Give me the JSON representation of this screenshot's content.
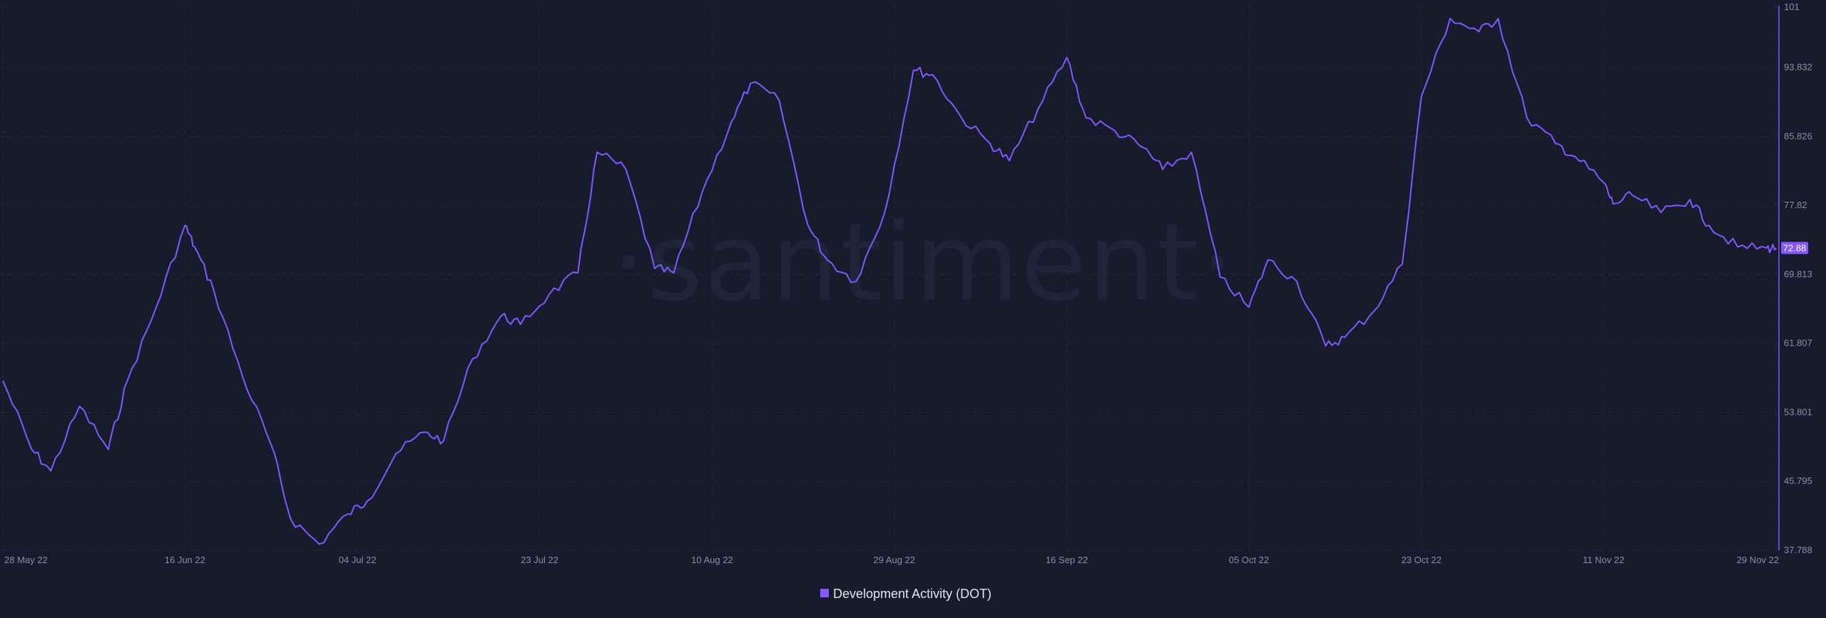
{
  "watermark": "·santiment·",
  "colors": {
    "background": "#181b2b",
    "series": "#8358ff",
    "grid": "#262a3d",
    "tick_text": "#8a8fa6"
  },
  "chart_data": {
    "type": "line",
    "title": "",
    "xlabel": "",
    "ylabel": "",
    "ylim": [
      37.788,
      101
    ],
    "yticks": [
      "101",
      "93.832",
      "85.826",
      "77.82",
      "69.813",
      "61.807",
      "53.801",
      "45.795",
      "37.788"
    ],
    "xticks": [
      "28 May 22",
      "16 Jun 22",
      "04 Jul 22",
      "23 Jul 22",
      "10 Aug 22",
      "29 Aug 22",
      "16 Sep 22",
      "05 Oct 22",
      "23 Oct 22",
      "11 Nov 22",
      "29 Nov 22"
    ],
    "last_value": "72.88",
    "grid": true,
    "legend_position": "bottom-center",
    "series": [
      {
        "name": "Development Activity (DOT)",
        "x": [
          "28 May 22",
          "31 May 22",
          "02 Jun 22",
          "05 Jun 22",
          "08 Jun 22",
          "10 Jun 22",
          "13 Jun 22",
          "16 Jun 22",
          "17 Jun 22",
          "19 Jun 22",
          "22 Jun 22",
          "25 Jun 22",
          "27 Jun 22",
          "30 Jun 22",
          "03 Jul 22",
          "05 Jul 22",
          "08 Jul 22",
          "11 Jul 22",
          "13 Jul 22",
          "16 Jul 22",
          "19 Jul 22",
          "21 Jul 22",
          "24 Jul 22",
          "27 Jul 22",
          "29 Jul 22",
          "01 Aug 22",
          "04 Aug 22",
          "06 Aug 22",
          "09 Aug 22",
          "12 Aug 22",
          "14 Aug 22",
          "17 Aug 22",
          "20 Aug 22",
          "22 Aug 22",
          "25 Aug 22",
          "28 Aug 22",
          "31 Aug 22",
          "02 Sep 22",
          "05 Sep 22",
          "08 Sep 22",
          "10 Sep 22",
          "13 Sep 22",
          "16 Sep 22",
          "18 Sep 22",
          "21 Sep 22",
          "24 Sep 22",
          "26 Sep 22",
          "29 Sep 22",
          "02 Oct 22",
          "05 Oct 22",
          "07 Oct 22",
          "10 Oct 22",
          "13 Oct 22",
          "15 Oct 22",
          "18 Oct 22",
          "21 Oct 22",
          "23 Oct 22",
          "26 Oct 22",
          "29 Oct 22",
          "31 Oct 22",
          "03 Nov 22",
          "06 Nov 22",
          "08 Nov 22",
          "11 Nov 22",
          "12 Nov 22",
          "14 Nov 22",
          "17 Nov 22",
          "20 Nov 22",
          "22 Nov 22",
          "25 Nov 22",
          "28 Nov 22",
          "29 Nov 22"
        ],
        "values": [
          57.5,
          49.5,
          47.0,
          54.5,
          49.5,
          57.5,
          66.0,
          75.5,
          73.0,
          68.0,
          58.0,
          50.0,
          41.5,
          38.5,
          42.0,
          43.5,
          49.0,
          51.5,
          50.5,
          60.0,
          65.0,
          64.0,
          67.5,
          70.0,
          84.0,
          82.0,
          70.5,
          70.0,
          79.5,
          87.5,
          92.0,
          90.0,
          75.5,
          71.5,
          69.0,
          77.0,
          93.5,
          93.0,
          88.0,
          85.0,
          83.0,
          89.0,
          95.0,
          88.0,
          86.5,
          84.5,
          82.0,
          84.0,
          69.5,
          66.0,
          71.5,
          69.0,
          61.5,
          62.5,
          65.5,
          71.0,
          90.5,
          99.5,
          98.0,
          99.5,
          88.0,
          85.0,
          83.5,
          80.5,
          78.0,
          79.0,
          77.0,
          78.5,
          75.5,
          73.0,
          72.88,
          72.88
        ]
      }
    ]
  }
}
